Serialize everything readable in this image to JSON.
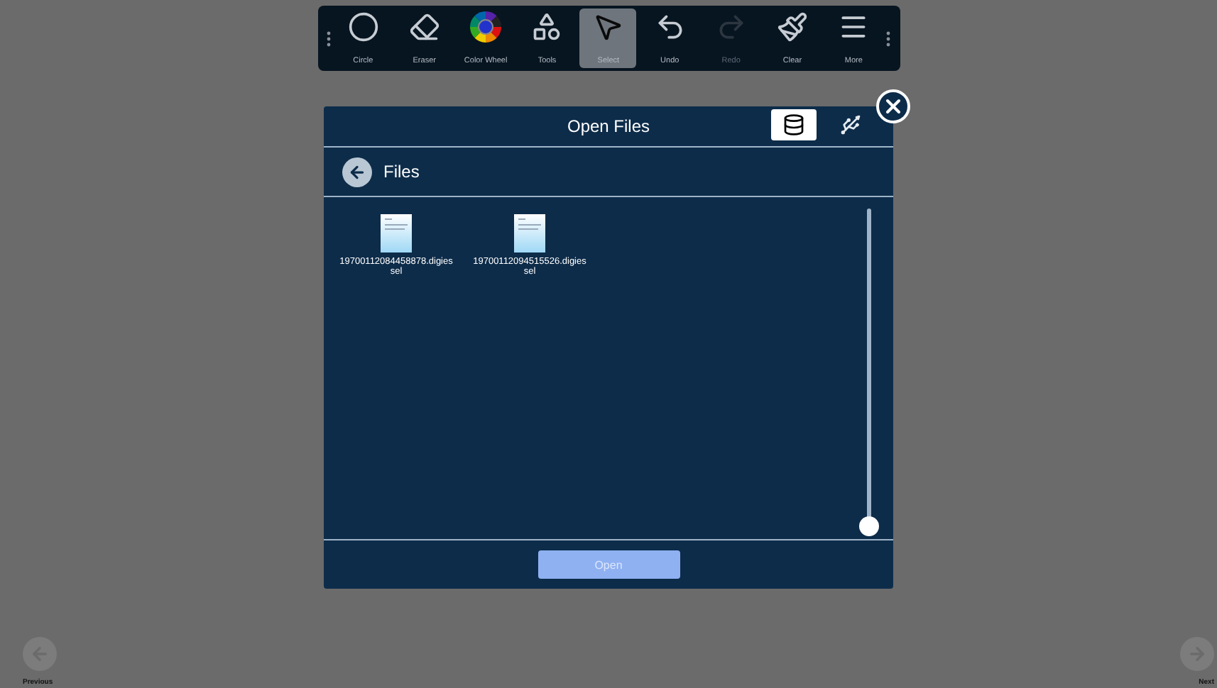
{
  "toolbar": {
    "tools": [
      {
        "kind": "circle",
        "label": "Circle",
        "selected": false,
        "disabled": false
      },
      {
        "kind": "eraser",
        "label": "Eraser",
        "selected": false,
        "disabled": false
      },
      {
        "kind": "wheel",
        "label": "Color Wheel",
        "selected": false,
        "disabled": false
      },
      {
        "kind": "tools",
        "label": "Tools",
        "selected": false,
        "disabled": false
      },
      {
        "kind": "select",
        "label": "Select",
        "selected": true,
        "disabled": false
      },
      {
        "kind": "undo",
        "label": "Undo",
        "selected": false,
        "disabled": false
      },
      {
        "kind": "redo",
        "label": "Redo",
        "selected": false,
        "disabled": true
      },
      {
        "kind": "clear",
        "label": "Clear",
        "selected": false,
        "disabled": false
      },
      {
        "kind": "more",
        "label": "More",
        "selected": false,
        "disabled": false
      }
    ]
  },
  "dialog": {
    "title": "Open Files",
    "sources": [
      {
        "kind": "database",
        "selected": true
      },
      {
        "kind": "usb",
        "selected": false
      }
    ],
    "folder": "Files",
    "files": [
      {
        "name": "19700112084458878.digies sel"
      },
      {
        "name": "19700112094515526.digies sel"
      }
    ],
    "open_button": {
      "label": "Open",
      "disabled": true
    }
  },
  "navigation": {
    "previous": "Previous",
    "next": "Next"
  }
}
